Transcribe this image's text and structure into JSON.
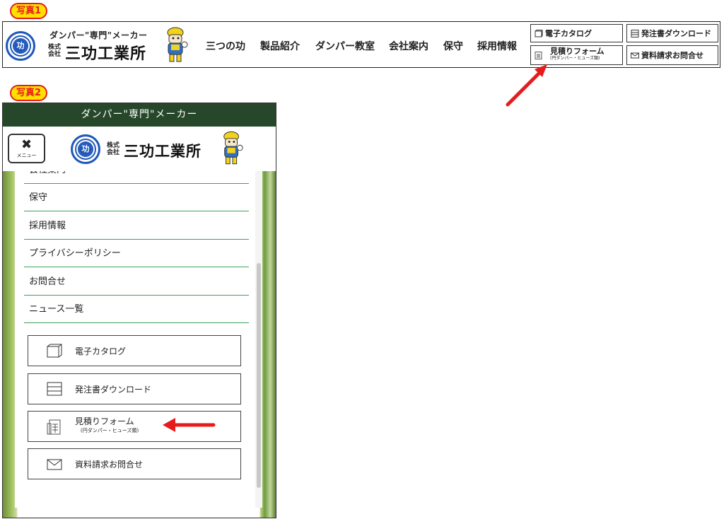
{
  "photo1": {
    "badge": "写真1",
    "header": {
      "tagline": "ダンパー\"専門\"メーカー",
      "kabushiki_line1": "株式",
      "kabushiki_line2": "会社",
      "company_name": "三功工業所",
      "logo_char": "功",
      "nav": [
        "三つの功",
        "製品紹介",
        "ダンパー教室",
        "会社案内",
        "保守",
        "採用情報"
      ],
      "buttons": {
        "catalog": "電子カタログ",
        "download": "発注書ダウンロード",
        "quote": "見積りフォーム",
        "quote_sub": "(円ダンパー・ヒューズ類)",
        "inquiry": "資料請求お問合せ"
      }
    }
  },
  "photo2": {
    "badge": "写真2",
    "topbar": "ダンパー\"専門\"メーカー",
    "menu_button": {
      "icon": "close-icon",
      "label": "メニュー"
    },
    "header": {
      "kabushiki_line1": "株式",
      "kabushiki_line2": "会社",
      "company_name": "三功工業所",
      "logo_char": "功"
    },
    "menu_items": [
      "会社案内",
      "保守",
      "採用情報",
      "プライバシーポリシー",
      "お問合せ",
      "ニュース一覧"
    ],
    "buttons": {
      "catalog": "電子カタログ",
      "download": "発注書ダウンロード",
      "quote": "見積りフォーム",
      "quote_sub": "(円ダンパー・ヒューズ類)",
      "inquiry": "資料請求お問合せ"
    }
  },
  "colors": {
    "brand_blue": "#1f58b8",
    "topbar_green": "#26472a",
    "divider_green": "#3aa35a",
    "arrow_red": "#e61c1c",
    "badge_yellow": "#ffe000"
  }
}
